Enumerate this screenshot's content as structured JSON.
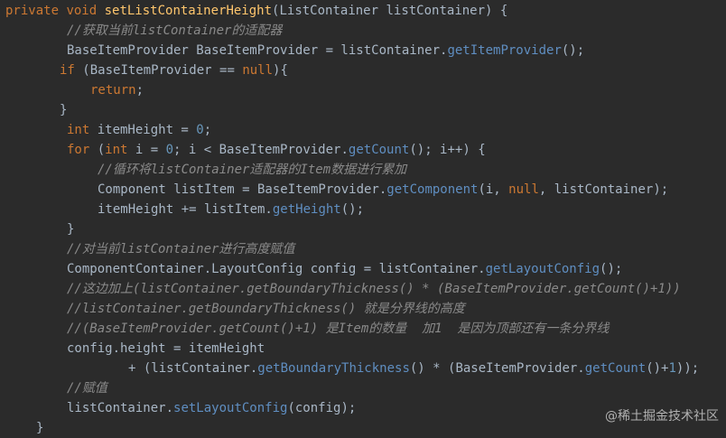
{
  "colors": {
    "background": "#2b2b2b",
    "keyword": "#cc7832",
    "method_decl": "#ffc66d",
    "method_call": "#5f8ec1",
    "number": "#6897bb",
    "comment": "#8a8a8a",
    "plain": "#a9b7c6"
  },
  "code": {
    "lines": [
      [
        {
          "t": "kw",
          "v": "private "
        },
        {
          "t": "kw",
          "v": "void "
        },
        {
          "t": "method",
          "v": "setListContainerHeight"
        },
        {
          "t": "plain",
          "v": "(ListContainer listContainer) {"
        }
      ],
      [
        {
          "t": "comment",
          "v": "//获取当前listContainer的适配器"
        }
      ],
      [
        {
          "t": "plain",
          "v": "BaseItemProvider BaseItemProvider = listContainer."
        },
        {
          "t": "call",
          "v": "getItemProvider"
        },
        {
          "t": "plain",
          "v": "();"
        }
      ],
      [
        {
          "t": "kw",
          "v": "if "
        },
        {
          "t": "plain",
          "v": "(BaseItemProvider == "
        },
        {
          "t": "kw",
          "v": "null"
        },
        {
          "t": "plain",
          "v": "){"
        }
      ],
      [
        {
          "t": "kw",
          "v": "return"
        },
        {
          "t": "plain",
          "v": ";"
        }
      ],
      [
        {
          "t": "plain",
          "v": "}"
        }
      ],
      [
        {
          "t": "kw",
          "v": "int "
        },
        {
          "t": "plain",
          "v": "itemHeight = "
        },
        {
          "t": "num",
          "v": "0"
        },
        {
          "t": "plain",
          "v": ";"
        }
      ],
      [
        {
          "t": "kw",
          "v": "for "
        },
        {
          "t": "plain",
          "v": "("
        },
        {
          "t": "kw",
          "v": "int "
        },
        {
          "t": "plain",
          "v": "i = "
        },
        {
          "t": "num",
          "v": "0"
        },
        {
          "t": "plain",
          "v": "; i < BaseItemProvider."
        },
        {
          "t": "call",
          "v": "getCount"
        },
        {
          "t": "plain",
          "v": "(); i++) {"
        }
      ],
      [
        {
          "t": "comment",
          "v": "//循环将listContainer适配器的Item数据进行累加"
        }
      ],
      [
        {
          "t": "plain",
          "v": "Component listItem = BaseItemProvider."
        },
        {
          "t": "call",
          "v": "getComponent"
        },
        {
          "t": "plain",
          "v": "(i, "
        },
        {
          "t": "kw",
          "v": "null"
        },
        {
          "t": "plain",
          "v": ", listContainer);"
        }
      ],
      [
        {
          "t": "plain",
          "v": "itemHeight += listItem."
        },
        {
          "t": "call",
          "v": "getHeight"
        },
        {
          "t": "plain",
          "v": "();"
        }
      ],
      [
        {
          "t": "plain",
          "v": "}"
        }
      ],
      [
        {
          "t": "comment",
          "v": "//对当前listContainer进行高度赋值"
        }
      ],
      [
        {
          "t": "plain",
          "v": "ComponentContainer.LayoutConfig config = listContainer."
        },
        {
          "t": "call",
          "v": "getLayoutConfig"
        },
        {
          "t": "plain",
          "v": "();"
        }
      ],
      [
        {
          "t": "comment",
          "v": "//这边加上(listContainer.getBoundaryThickness() * (BaseItemProvider.getCount()+1))"
        }
      ],
      [
        {
          "t": "comment",
          "v": "//listContainer.getBoundaryThickness() 就是分界线的高度"
        }
      ],
      [
        {
          "t": "comment",
          "v": "//(BaseItemProvider.getCount()+1) 是Item的数量  加1  是因为顶部还有一条分界线"
        }
      ],
      [
        {
          "t": "plain",
          "v": "config.height = itemHeight"
        }
      ],
      [
        {
          "t": "plain",
          "v": "+ (listContainer."
        },
        {
          "t": "call",
          "v": "getBoundaryThickness"
        },
        {
          "t": "plain",
          "v": "() * (BaseItemProvider."
        },
        {
          "t": "call",
          "v": "getCount"
        },
        {
          "t": "plain",
          "v": "()+"
        },
        {
          "t": "num",
          "v": "1"
        },
        {
          "t": "plain",
          "v": "));"
        }
      ],
      [
        {
          "t": "comment",
          "v": "//赋值"
        }
      ],
      [
        {
          "t": "plain",
          "v": "listContainer."
        },
        {
          "t": "call",
          "v": "setLayoutConfig"
        },
        {
          "t": "plain",
          "v": "(config);"
        }
      ],
      [
        {
          "t": "plain",
          "v": "}"
        }
      ]
    ]
  },
  "watermark": {
    "text": "@稀土掘金技术社区"
  }
}
